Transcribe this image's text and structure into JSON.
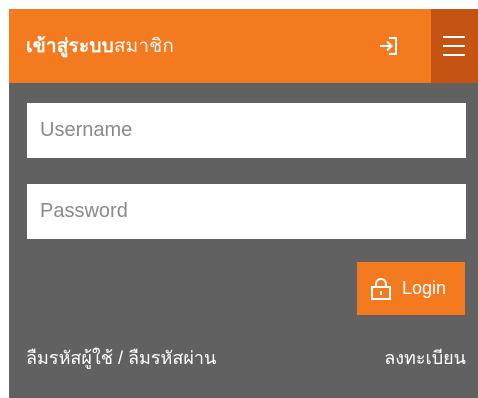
{
  "header": {
    "title_bold": "เข้าสู่ระบบ",
    "title_light": "สมาชิก"
  },
  "form": {
    "username_placeholder": "Username",
    "password_placeholder": "Password",
    "login_label": "Login"
  },
  "links": {
    "forgot": "ลืมรหัสผู้ใช้ / ลืมรหัสผ่าน",
    "register": "ลงทะเบียน"
  },
  "colors": {
    "accent": "#f47a20",
    "accent_dark": "#c55414",
    "panel": "#616161"
  },
  "icons": {
    "header_login": "login-arrow-icon",
    "menu": "hamburger-menu-icon",
    "button_lock": "lock-icon"
  }
}
